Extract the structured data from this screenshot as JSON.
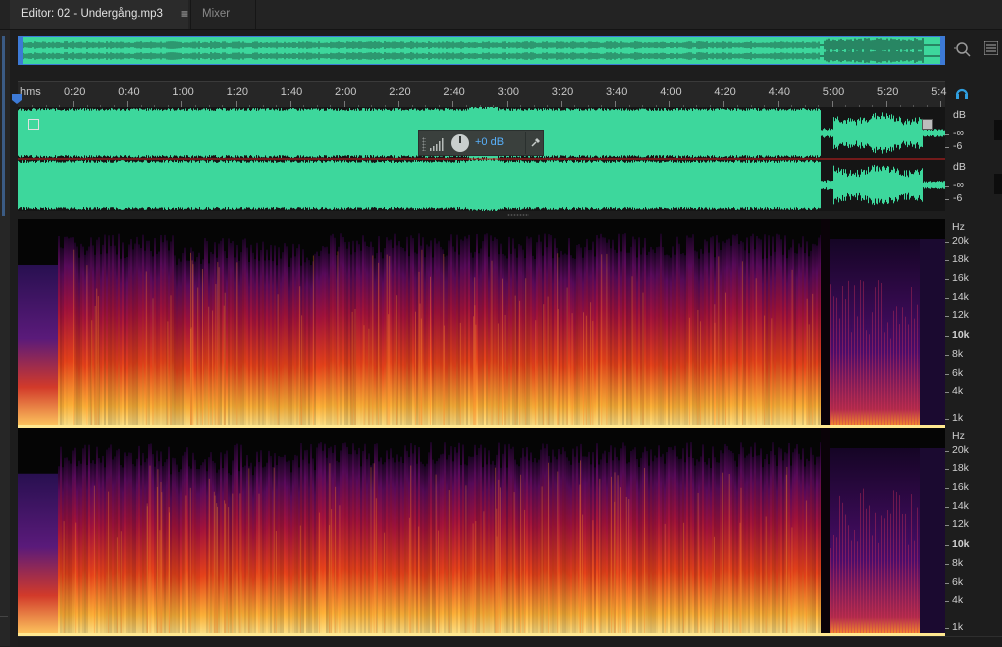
{
  "tabs": {
    "editor_label": "Editor: 02 - Undergång.mp3",
    "editor_menu_glyph": "≡",
    "mixer_label": "Mixer"
  },
  "ruler": {
    "unit": "hms",
    "ticks": [
      "0:20",
      "0:40",
      "1:00",
      "1:20",
      "1:40",
      "2:00",
      "2:20",
      "2:40",
      "3:00",
      "3:20",
      "3:40",
      "4:00",
      "4:20",
      "4:40",
      "5:00",
      "5:20",
      "5:4"
    ]
  },
  "hud": {
    "gain_value": "+0 dB"
  },
  "db_scale": {
    "top": {
      "unit": "dB",
      "labels": [
        "-∞",
        "-6"
      ]
    },
    "bottom": {
      "unit": "dB",
      "labels": [
        "-∞",
        "-6"
      ]
    }
  },
  "hz_scale": {
    "unit": "Hz",
    "labels": [
      "20k",
      "18k",
      "16k",
      "14k",
      "12k",
      "10k",
      "8k",
      "6k",
      "4k",
      "1k"
    ]
  },
  "colors": {
    "waveform": "#3dd79c",
    "accent": "#3d7ad6",
    "playhead_line": "#d02020"
  },
  "icons": [
    "zoom-icon",
    "list-icon",
    "headphones-icon",
    "pin-icon",
    "level-meter-icon"
  ]
}
